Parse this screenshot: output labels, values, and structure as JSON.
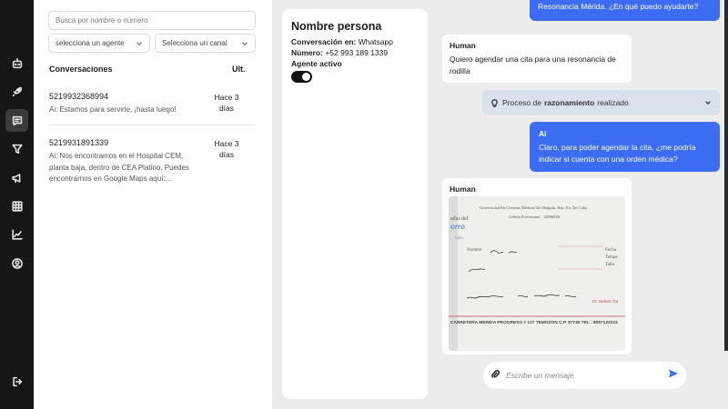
{
  "sidebar": {
    "icons": [
      "bot-icon",
      "rocket-icon",
      "chat-icon",
      "filter-icon",
      "megaphone-icon",
      "table-icon",
      "chart-icon",
      "user-circle-icon",
      "logout-icon"
    ],
    "active": "chat-icon"
  },
  "filters": {
    "search_placeholder": "Busca por nombre o número",
    "agent_select": "selecciona un agente",
    "channel_select": "Selecciona un canal"
  },
  "list": {
    "header_left": "Conversaciones",
    "header_right": "Ult.",
    "items": [
      {
        "number": "5219932368994",
        "preview": "Ai: Estamos para servirle, ¡hasta luego!",
        "time_line1": "Hace 3",
        "time_line2": "días"
      },
      {
        "number": "5219931891339",
        "preview": "Ai: Nos encontramos en el Hospital CEM, planta baja, dentro de CEA Platino. Puedes encontrarnos en Google Maps aquí:...",
        "time_line1": "Hace 3",
        "time_line2": "días"
      }
    ]
  },
  "contact": {
    "name": "Nombre persona",
    "channel_label": "Conversación en:",
    "channel_value": "Whatsapp",
    "number_label": "Número:",
    "number_value": "+52 993 189 1339",
    "agent_label": "Agente activo",
    "agent_active": true
  },
  "chat": {
    "messages": [
      {
        "role": "",
        "text": "Resonancia Mérida. ¿En qué puedo ayudarte?"
      },
      {
        "role": "Human",
        "text": "Quiero agendar una cita para una resonancia de rodilla"
      },
      {
        "role": "Ai",
        "text": "Claro, para poder agendar la cita, ¿me podría indicar si cuenta con una orden médica?"
      },
      {
        "role": "Human",
        "text": ""
      }
    ],
    "reasoning": {
      "prefix": "Proceso de",
      "bold": "razonamiento",
      "suffix": "realizado"
    },
    "attachment": {
      "header1": "Universidad En Ciencias Médicas De Helguín. Hsp. En. De Cuba",
      "header2": "Cédula Profesional : 12696048",
      "left_text1": "adas del",
      "left_brand": "orro",
      "left_text2": "... bien.",
      "field_name": "Nombre",
      "field_date": "Fecha",
      "right_fields": [
        "Fecha",
        "Tempe",
        "Talla"
      ],
      "signature_note": "Dr. Nelson Gu",
      "address": "CARRETERA MERIDA PROGRESO # 127 TEMOZON C.P. 97740 TEL : 8067122223"
    },
    "composer_placeholder": "Escribe un mensaje"
  },
  "colors": {
    "accent": "#3b6cf1",
    "rail": "#161616",
    "reasoning_bg": "#d9e2ec"
  }
}
